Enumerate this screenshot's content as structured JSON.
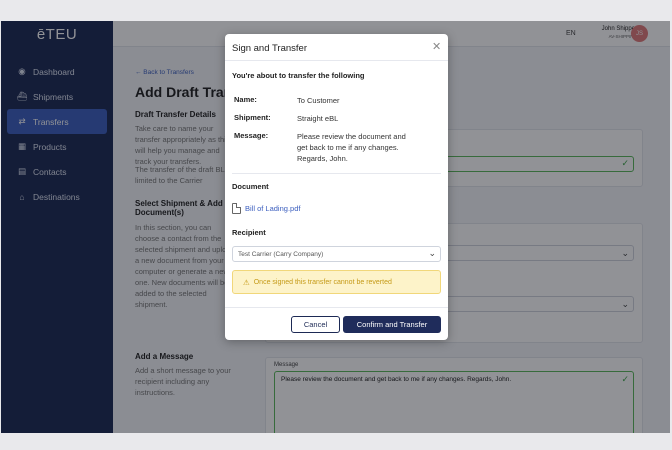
{
  "app": {
    "logo": "ēTEU"
  },
  "sidebar": {
    "items": [
      {
        "label": "Dashboard",
        "icon": "gauge-icon",
        "glyph": "◉"
      },
      {
        "label": "Shipments",
        "icon": "ship-icon",
        "glyph": "⛴"
      },
      {
        "label": "Transfers",
        "icon": "transfer-icon",
        "glyph": "⇄",
        "active": true
      },
      {
        "label": "Products",
        "icon": "box-icon",
        "glyph": "▦"
      },
      {
        "label": "Contacts",
        "icon": "contact-card-icon",
        "glyph": "▤"
      },
      {
        "label": "Destinations",
        "icon": "building-icon",
        "glyph": "⌂"
      }
    ]
  },
  "topbar": {
    "lang": "EN",
    "user_name": "John Shipper",
    "company": "AV-SHIPPING",
    "initials": "JS"
  },
  "page": {
    "back": "← Back to Transfers",
    "title": "Add Draft Transfer",
    "details_title": "Draft Transfer Details",
    "details_text": "Take care to name your transfer appropriately as this will help you manage and track your transfers.",
    "details_text2": "The transfer of the draft BL is limited to the Carrier",
    "select_title": "Select Shipment & Add Document(s)",
    "select_text": "In this section, you can choose a contact from the selected shipment and upload a new document from your computer or generate a new one. New documents will be added to the selected shipment.",
    "message_title": "Add a Message",
    "message_text": "Add a short message to your recipient including any instructions.",
    "message_label": "Message",
    "message_value": "Please review the document and get back to me if any changes. Regards, John."
  },
  "modal": {
    "title": "Sign and Transfer",
    "subtitle": "You're about to transfer the following",
    "name_label": "Name:",
    "name_value": "To Customer",
    "shipment_label": "Shipment:",
    "shipment_value": "Straight eBL",
    "message_label": "Message:",
    "message_value": "Please review the document and get back to me if any changes. Regards, John.",
    "document_heading": "Document",
    "document_link": "Bill of Lading.pdf",
    "recipient_heading": "Recipient",
    "recipient_value": "Test Carrier (Carry Company)",
    "warning": "Once signed this transfer cannot be reverted",
    "cancel": "Cancel",
    "confirm": "Confirm and Transfer"
  },
  "colors": {
    "sidebar": "#1d2a55",
    "accent": "#3c5fbf",
    "primary_button": "#1f2c5b",
    "warning_bg": "#fdf3c9",
    "success": "#3ea64a"
  }
}
